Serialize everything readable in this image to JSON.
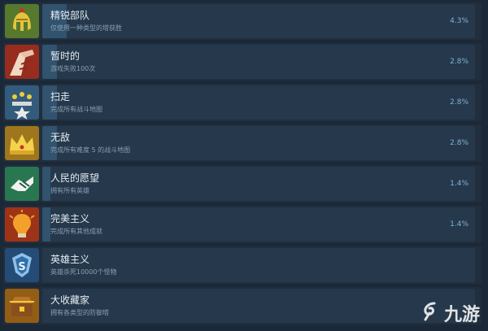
{
  "achievements": [
    {
      "title": "精锐部队",
      "desc": "仅使用一种类型的塔获胜",
      "percent": "4.3%",
      "fill": 0.043,
      "icon": "spartan-helmet-icon"
    },
    {
      "title": "暂时的",
      "desc": "游戏失败100次",
      "percent": "2.8%",
      "fill": 0.028,
      "icon": "broken-hand-icon"
    },
    {
      "title": "扫走",
      "desc": "完成所有战斗地图",
      "percent": "2.8%",
      "fill": 0.028,
      "icon": "star-badge-icon"
    },
    {
      "title": "无敌",
      "desc": "完成所有难度 5 的战斗地图",
      "percent": "2.8%",
      "fill": 0.028,
      "icon": "crown-icon"
    },
    {
      "title": "人民的愿望",
      "desc": "拥有所有英雄",
      "percent": "1.4%",
      "fill": 0.014,
      "icon": "handshake-icon"
    },
    {
      "title": "完美主义",
      "desc": "完成所有其他成就",
      "percent": "1.4%",
      "fill": 0.014,
      "icon": "lightbulb-icon"
    },
    {
      "title": "英雄主义",
      "desc": "英雄杀死10000个怪物",
      "percent": "",
      "fill": 0.0,
      "icon": "hero-emblem-icon"
    },
    {
      "title": "大收藏家",
      "desc": "拥有各类型的防御塔",
      "percent": "",
      "fill": 0.0,
      "icon": "treasure-chest-icon"
    }
  ],
  "watermark": {
    "text": "九游",
    "icon": "jiuyou-logo-icon"
  }
}
